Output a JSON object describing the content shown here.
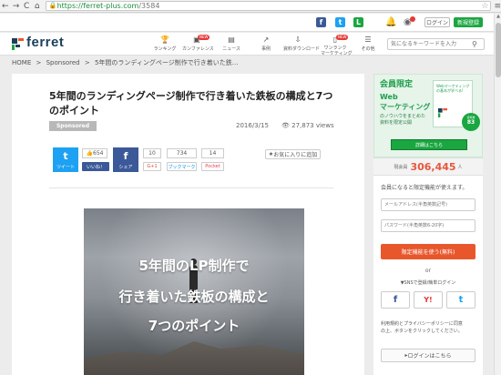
{
  "browser": {
    "url_host": "https://ferret-plus.com",
    "url_path": "/3584",
    "back_glyph": "←",
    "forward_glyph": "→",
    "reload_glyph": "C",
    "home_glyph": "⌂"
  },
  "util_bar": {
    "login_label": "ログイン",
    "register_label": "新規登録"
  },
  "header": {
    "logo_text": "ferret",
    "nav": [
      {
        "label": "ランキング"
      },
      {
        "label": "カンファレンス",
        "badge": "NEW"
      },
      {
        "label": "ニュース"
      },
      {
        "label": "事例"
      },
      {
        "label": "資料ダウンロード"
      },
      {
        "label": "ワンランク\nマーケティング",
        "badge": "NEW"
      },
      {
        "label": "その他"
      }
    ],
    "search_placeholder": "気になるキーワードを入力"
  },
  "breadcrumb": {
    "home": "HOME",
    "sep1": ">",
    "category": "Sponsored",
    "sep2": ">",
    "current": "5年間のランディングページ制作で行き着いた鉄..."
  },
  "article": {
    "title": "5年間のランディングページ制作で行き着いた鉄板の構成と7つのポイント",
    "tag": "Sponsored",
    "date": "2016/3/15",
    "views": "27,873 views",
    "share": {
      "tweet_label": "ツイート",
      "facebook_share_label": "シェア",
      "like_count": "654",
      "like_label": "いいね！",
      "gplus_count": "10",
      "gplus_label": "G+1",
      "hatena_count": "734",
      "hatena_label": "ブックマーク",
      "pocket_count": "14",
      "pocket_label": "Pocket",
      "favorite_label": "お気に入りに追加"
    },
    "hero": {
      "line1": "5年間のLP制作で",
      "line2": "行き着いた鉄板の構成と",
      "line3": "7つのポイント"
    }
  },
  "sidebar": {
    "banner": {
      "head1": "会員限定",
      "head2": "Web",
      "head3": "マーケティング",
      "sub1": "のノウハウをまとめた",
      "sub2": "資料を限定公開",
      "booklet_title": "Webマーケティングの基本が学べる!",
      "badge_line1": "資料数",
      "badge_line2": "83",
      "button": "詳細はこちら"
    },
    "register": {
      "member_prefix": "現会員",
      "member_count": "306,445",
      "member_suffix": "人",
      "note": "会員になると限定機能が使えます。",
      "email_placeholder": "メールアドレス(半角英数記号)",
      "password_placeholder": "パスワード(半角英数6-20字)",
      "submit": "限定機能を使う(無料)",
      "or": "or",
      "sns_label": "▼SNSで登録/簡単ログイン",
      "policy1": "利用規約とプライバシーポリシーに同意",
      "policy2": "の上、ボタンをクリックしてください。",
      "login_link": "ログインはこちら"
    }
  },
  "colors": {
    "brand_green": "#1aa640",
    "accent_orange": "#e8572c",
    "twitter_blue": "#1da1f2",
    "facebook_blue": "#3b5998"
  }
}
